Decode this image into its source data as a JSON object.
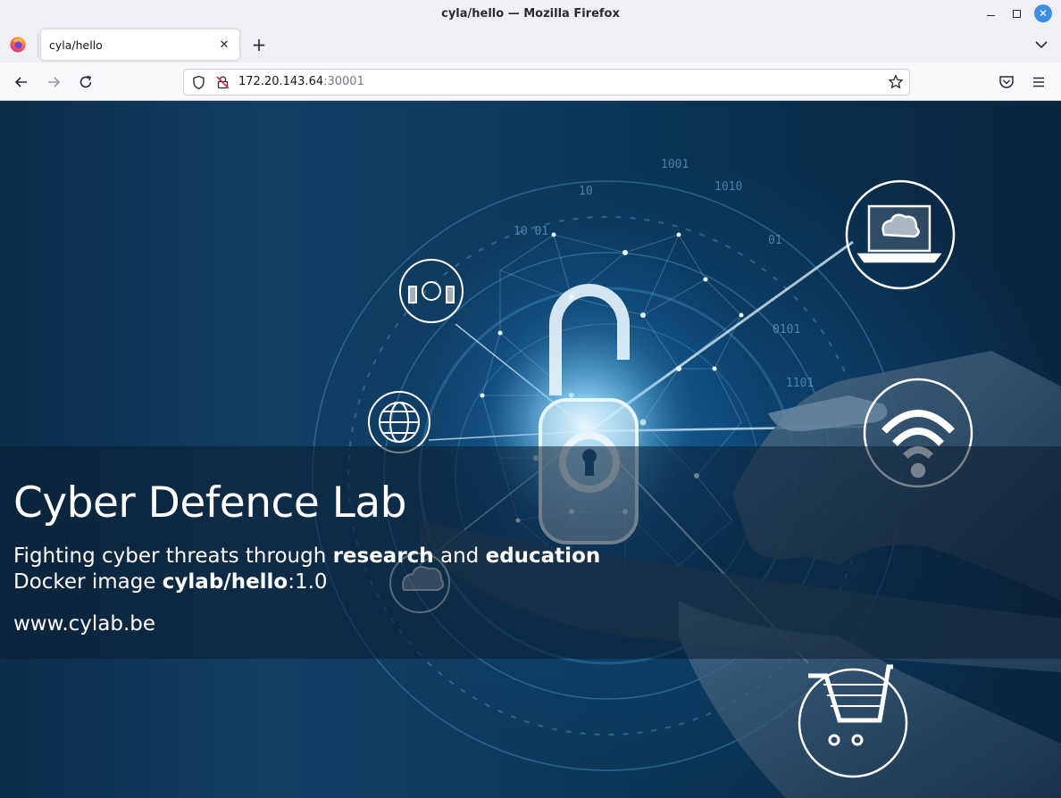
{
  "window": {
    "title": "cyla/hello — Mozilla Firefox"
  },
  "tabs": [
    {
      "label": "cyla/hello",
      "active": true
    }
  ],
  "urlbar": {
    "host": "172.20.143.64",
    "port": ":30001"
  },
  "hero": {
    "headline": "Cyber Defence Lab",
    "line1": {
      "prefix": "Fighting cyber threats through ",
      "strong1": "research",
      "middle": " and ",
      "strong2": "education"
    },
    "line2": {
      "prefix": "Docker image ",
      "strong": "cylab/hello",
      "suffix": ":1.0"
    },
    "website": "www.cylab.be",
    "binary_digits": [
      "10",
      "1001",
      "1010",
      "01",
      "0101",
      "10 01",
      "1101"
    ]
  },
  "icons": {
    "firefox": "firefox-logo-icon",
    "back": "back-arrow-icon",
    "forward": "forward-arrow-icon",
    "reload": "reload-icon",
    "shield": "tracking-shield-icon",
    "insecure": "insecure-lock-icon",
    "bookmark": "bookmark-star-icon",
    "pocket": "pocket-icon",
    "menu": "hamburger-menu-icon",
    "tab_list": "chevron-down-icon"
  },
  "colors": {
    "accent": "#3a8ee6",
    "chrome": "#f0f0f4",
    "page_bg": "#0b2d4b",
    "glow": "#9fe0ff"
  }
}
